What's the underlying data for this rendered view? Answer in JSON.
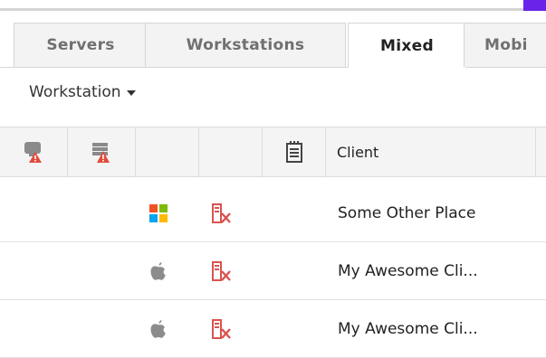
{
  "tabs": [
    {
      "label": "Servers",
      "active": false
    },
    {
      "label": "Workstations",
      "active": false
    },
    {
      "label": "Mixed",
      "active": true
    },
    {
      "label": "Mobi",
      "active": false
    }
  ],
  "filter": {
    "selected": "Workstation"
  },
  "table": {
    "columns": [
      {
        "icon": "monitor-alert-icon"
      },
      {
        "icon": "device-alert-icon"
      },
      {
        "icon": ""
      },
      {
        "icon": ""
      },
      {
        "icon": "notes-icon"
      },
      {
        "label": "Client"
      }
    ],
    "rows": [
      {
        "os_icon": "windows-icon",
        "status_icon": "offline-icon",
        "client": "Some Other Place"
      },
      {
        "os_icon": "apple-icon",
        "status_icon": "offline-icon",
        "client": "My Awesome Cli..."
      },
      {
        "os_icon": "apple-icon",
        "status_icon": "offline-icon",
        "client": "My Awesome Cli..."
      }
    ]
  },
  "colors": {
    "accent": "#6a23e8",
    "alert": "#e24b3b",
    "offline": "#d9534f"
  }
}
